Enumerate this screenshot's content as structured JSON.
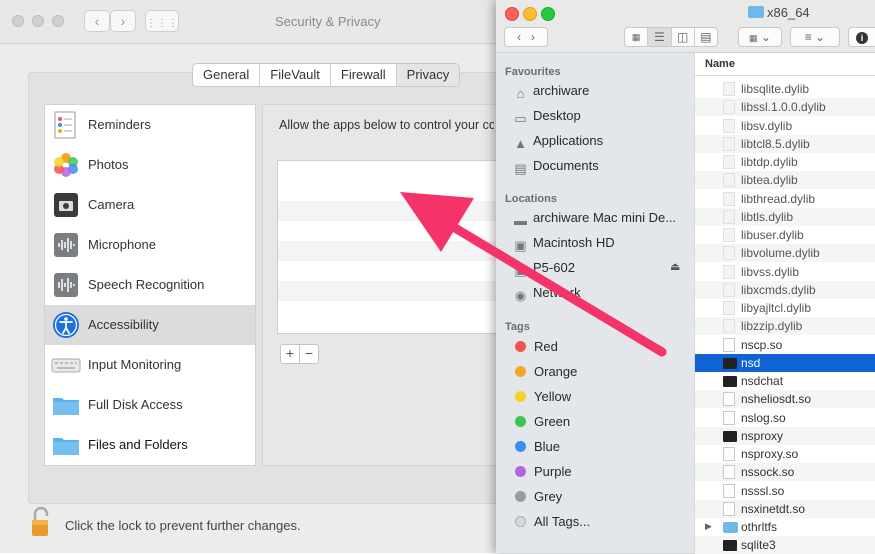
{
  "security": {
    "title": "Security & Privacy",
    "tabs": [
      "General",
      "FileVault",
      "Firewall",
      "Privacy"
    ],
    "categories": [
      {
        "label": "Reminders",
        "icon": "reminders-icon"
      },
      {
        "label": "Photos",
        "icon": "photos-icon"
      },
      {
        "label": "Camera",
        "icon": "camera-icon"
      },
      {
        "label": "Microphone",
        "icon": "microphone-icon"
      },
      {
        "label": "Speech Recognition",
        "icon": "speech-recognition-icon"
      },
      {
        "label": "Accessibility",
        "icon": "accessibility-icon",
        "selected": true
      },
      {
        "label": "Input Monitoring",
        "icon": "keyboard-icon"
      },
      {
        "label": "Full Disk Access",
        "icon": "folder-icon"
      },
      {
        "label": "Files and Folders",
        "icon": "folder-icon"
      }
    ],
    "allow_text": "Allow the apps below to control your computer.",
    "add_label": "+",
    "remove_label": "−",
    "lock_text": "Click the lock to prevent further changes."
  },
  "finder": {
    "title": "x86_64",
    "favourites_label": "Favourites",
    "favourites": [
      {
        "label": "archiware",
        "icon": "home-icon"
      },
      {
        "label": "Desktop",
        "icon": "desktop-icon"
      },
      {
        "label": "Applications",
        "icon": "applications-icon"
      },
      {
        "label": "Documents",
        "icon": "documents-icon"
      }
    ],
    "locations_label": "Locations",
    "locations": [
      {
        "label": "archiware Mac mini De...",
        "icon": "computer-icon"
      },
      {
        "label": "Macintosh HD",
        "icon": "disk-icon"
      },
      {
        "label": "P5-602",
        "icon": "disk-icon"
      },
      {
        "label": "Network",
        "icon": "network-icon"
      }
    ],
    "tags_label": "Tags",
    "tags": [
      {
        "label": "Red",
        "color": "#f0544f"
      },
      {
        "label": "Orange",
        "color": "#f5a623"
      },
      {
        "label": "Yellow",
        "color": "#f5d327"
      },
      {
        "label": "Green",
        "color": "#3cc651"
      },
      {
        "label": "Blue",
        "color": "#3b8ef0"
      },
      {
        "label": "Purple",
        "color": "#b266d8"
      },
      {
        "label": "Grey",
        "color": "#9b9b9b"
      },
      {
        "label": "All Tags...",
        "color": "#d8d8d8"
      }
    ],
    "column_header": "Name",
    "files": [
      {
        "name": "libsqlite.dylib",
        "kind": "dylib"
      },
      {
        "name": "libssl.1.0.0.dylib",
        "kind": "dylib"
      },
      {
        "name": "libsv.dylib",
        "kind": "dylib"
      },
      {
        "name": "libtcl8.5.dylib",
        "kind": "dylib"
      },
      {
        "name": "libtdp.dylib",
        "kind": "dylib"
      },
      {
        "name": "libtea.dylib",
        "kind": "dylib"
      },
      {
        "name": "libthread.dylib",
        "kind": "dylib"
      },
      {
        "name": "libtls.dylib",
        "kind": "dylib"
      },
      {
        "name": "libuser.dylib",
        "kind": "dylib"
      },
      {
        "name": "libvolume.dylib",
        "kind": "dylib"
      },
      {
        "name": "libvss.dylib",
        "kind": "dylib"
      },
      {
        "name": "libxcmds.dylib",
        "kind": "dylib"
      },
      {
        "name": "libyajltcl.dylib",
        "kind": "dylib"
      },
      {
        "name": "libzzip.dylib",
        "kind": "dylib"
      },
      {
        "name": "nscp.so",
        "kind": "doc"
      },
      {
        "name": "nsd",
        "kind": "exe",
        "selected": true
      },
      {
        "name": "nsdchat",
        "kind": "exe"
      },
      {
        "name": "nsheliosdt.so",
        "kind": "doc"
      },
      {
        "name": "nslog.so",
        "kind": "doc"
      },
      {
        "name": "nsproxy",
        "kind": "exe"
      },
      {
        "name": "nsproxy.so",
        "kind": "doc"
      },
      {
        "name": "nssock.so",
        "kind": "doc"
      },
      {
        "name": "nsssl.so",
        "kind": "doc"
      },
      {
        "name": "nsxinetdt.so",
        "kind": "doc"
      },
      {
        "name": "othrltfs",
        "kind": "folder"
      },
      {
        "name": "sqlite3",
        "kind": "exe"
      }
    ]
  },
  "annotation": {
    "color": "#f5336b"
  }
}
